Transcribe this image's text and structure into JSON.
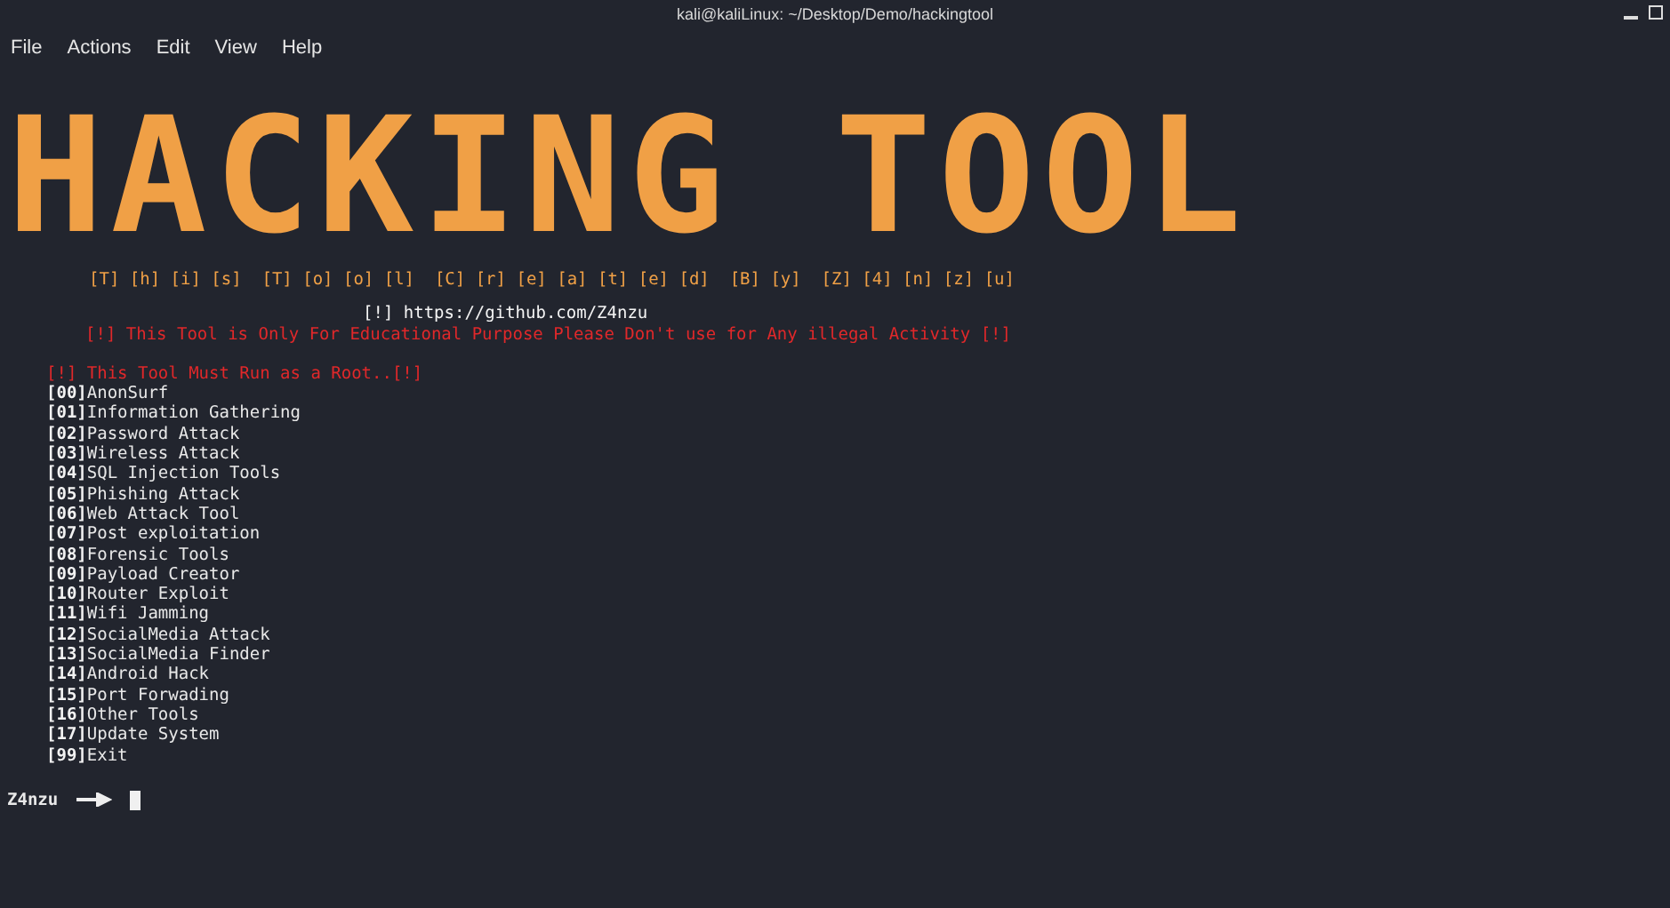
{
  "window": {
    "title": "kali@kaliLinux: ~/Desktop/Demo/hackingtool"
  },
  "menu": [
    "File",
    "Actions",
    "Edit",
    "View",
    "Help"
  ],
  "terminal": {
    "banner": "HACKING TOOL",
    "credit": "[T] [h] [i] [s]  [T] [o] [o] [l]  [C] [r] [e] [a] [t] [e] [d]  [B] [y]  [Z] [4] [n] [z] [u]",
    "link": "[!] https://github.com/Z4nzu",
    "warning": "[!] This Tool is Only For Educational Purpose Please Don't use for Any illegal Activity [!]",
    "root_notice": "[!] This Tool Must Run as a Root..[!]",
    "options": [
      {
        "number": "[00]",
        "label": "AnonSurf"
      },
      {
        "number": "[01]",
        "label": "Information Gathering"
      },
      {
        "number": "[02]",
        "label": "Password Attack"
      },
      {
        "number": "[03]",
        "label": "Wireless Attack"
      },
      {
        "number": "[04]",
        "label": "SQL Injection Tools"
      },
      {
        "number": "[05]",
        "label": "Phishing Attack"
      },
      {
        "number": "[06]",
        "label": "Web Attack Tool"
      },
      {
        "number": "[07]",
        "label": "Post exploitation"
      },
      {
        "number": "[08]",
        "label": "Forensic Tools"
      },
      {
        "number": "[09]",
        "label": "Payload Creator"
      },
      {
        "number": "[10]",
        "label": "Router Exploit"
      },
      {
        "number": "[11]",
        "label": "Wifi Jamming"
      },
      {
        "number": "[12]",
        "label": "SocialMedia Attack"
      },
      {
        "number": "[13]",
        "label": "SocialMedia Finder"
      },
      {
        "number": "[14]",
        "label": "Android Hack"
      },
      {
        "number": "[15]",
        "label": "Port Forwading"
      },
      {
        "number": "[16]",
        "label": "Other Tools"
      },
      {
        "number": "[17]",
        "label": "Update System"
      },
      {
        "number": "[99]",
        "label": "Exit"
      }
    ],
    "prompt": "Z4nzu"
  }
}
